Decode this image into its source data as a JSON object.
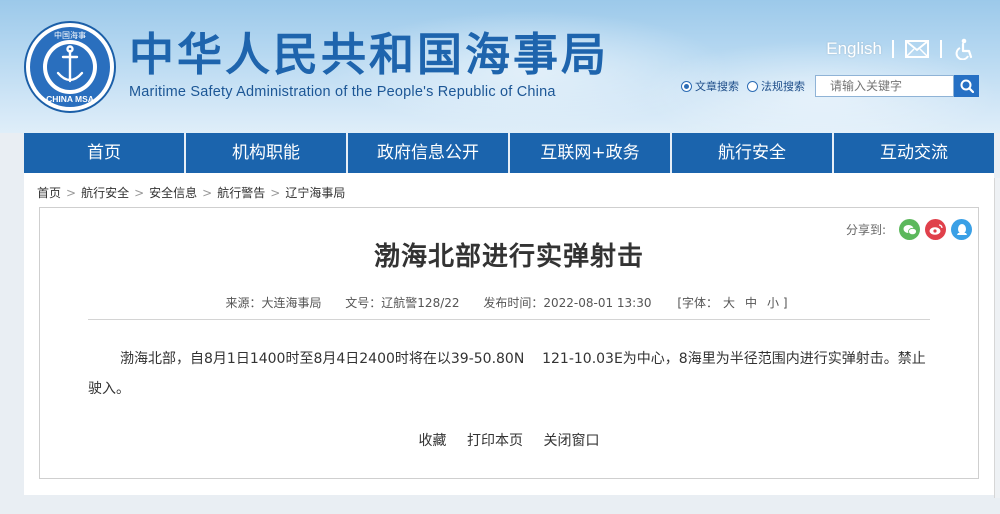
{
  "header": {
    "site_title": "中华人民共和国海事局",
    "site_subtitle": "Maritime Safety Administration of the People's Republic of China",
    "logo_text_top": "中国海事",
    "logo_text_bottom": "CHINA MSA",
    "english_link": "English",
    "mail_icon": "mail-icon",
    "accessibility_icon": "accessibility-icon"
  },
  "search": {
    "option_article": "文章搜索",
    "option_regulation": "法规搜索",
    "selected": "文章搜索",
    "placeholder": "请输入关键字",
    "icon": "search-icon"
  },
  "nav": {
    "items": [
      "首页",
      "机构职能",
      "政府信息公开",
      "互联网+政务",
      "航行安全",
      "互动交流"
    ]
  },
  "breadcrumb": {
    "items": [
      "首页",
      "航行安全",
      "安全信息",
      "航行警告",
      "辽宁海事局"
    ],
    "separator": ">"
  },
  "share": {
    "label": "分享到:",
    "icons": [
      "wechat-icon",
      "weibo-icon",
      "qq-icon"
    ],
    "colors": {
      "wechat": "#5cb85c",
      "weibo": "#e0404b",
      "qq": "#3aa0e6"
    }
  },
  "article": {
    "title": "渤海北部进行实弹射击",
    "meta": {
      "source": "来源：大连海事局",
      "doc_no": "文号：辽航警128/22",
      "published": "发布时间：2022-08-01 13:30",
      "font_label": "[字体：",
      "font_large": "大",
      "font_medium": "中",
      "font_small": "小 ]"
    },
    "body": "渤海北部，自8月1日1400时至8月4日2400时将在以39-50.80N    121-10.03E为中心，8海里为半径范围内进行实弹射击。禁止驶入。"
  },
  "actions": {
    "favorite": "收藏",
    "print": "打印本页",
    "close": "关闭窗口"
  },
  "colors": {
    "brand_blue": "#1b64ad",
    "title_blue": "#1e64ad"
  }
}
